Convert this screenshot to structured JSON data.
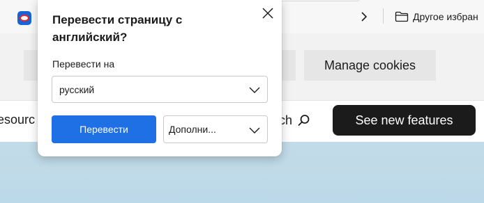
{
  "bookmarks_bar": {
    "other_bookmarks_label": "Другое избран"
  },
  "page": {
    "manage_cookies_label": "Manage cookies",
    "nav_resources_label": "esourc",
    "nav_search_label": "arch",
    "see_new_features_label": "See new features"
  },
  "translate_popup": {
    "title": "Перевести страницу с английский?",
    "target_label": "Перевести на",
    "target_language": "русский",
    "translate_button_label": "Перевести",
    "more_options_label": "Дополни..."
  },
  "colors": {
    "primary_button": "#1f6fe5",
    "dark_button": "#1b1b1b",
    "hero_background": "#bcd9e9"
  }
}
